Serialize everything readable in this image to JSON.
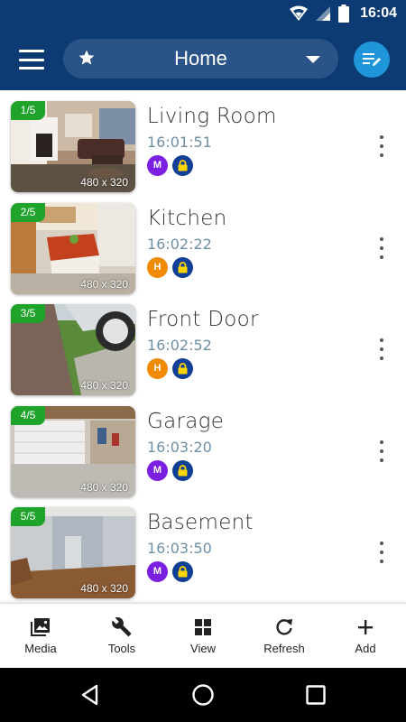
{
  "status_bar": {
    "time": "16:04"
  },
  "header": {
    "selected_group": "Home"
  },
  "colors": {
    "app_bar": "#0b3b72",
    "pill": "#2a5488",
    "edit_button": "#1e96d9",
    "badge_green": "#1fa32b",
    "timestamp": "#6f8fa3",
    "chip_m": "#7b1fe0",
    "chip_h": "#f08a00",
    "lock_blue": "#123f96",
    "lock_gold": "#ffd600"
  },
  "cameras": [
    {
      "index": "1/5",
      "name": "Living Room",
      "time": "16:01:51",
      "resolution": "480 x 320",
      "mode": "M",
      "mode_color": "#7b1fe0"
    },
    {
      "index": "2/5",
      "name": "Kitchen",
      "time": "16:02:22",
      "resolution": "480 x 320",
      "mode": "H",
      "mode_color": "#f08a00"
    },
    {
      "index": "3/5",
      "name": "Front Door",
      "time": "16:02:52",
      "resolution": "480 x 320",
      "mode": "H",
      "mode_color": "#f08a00"
    },
    {
      "index": "4/5",
      "name": "Garage",
      "time": "16:03:20",
      "resolution": "480 x 320",
      "mode": "M",
      "mode_color": "#7b1fe0"
    },
    {
      "index": "5/5",
      "name": "Basement",
      "time": "16:03:50",
      "resolution": "480 x 320",
      "mode": "M",
      "mode_color": "#7b1fe0"
    }
  ],
  "bottom_nav": [
    {
      "label": "Media",
      "icon": "media-icon"
    },
    {
      "label": "Tools",
      "icon": "wrench-icon"
    },
    {
      "label": "View",
      "icon": "grid-icon"
    },
    {
      "label": "Refresh",
      "icon": "refresh-icon"
    },
    {
      "label": "Add",
      "icon": "plus-icon"
    }
  ],
  "icons": {
    "wifi": "wifi-icon",
    "signal": "cell-signal-icon",
    "battery": "battery-icon",
    "menu": "hamburger-menu-icon",
    "star": "star-icon",
    "dropdown": "caret-down-icon",
    "edit": "edit-list-icon",
    "more": "more-vertical-icon",
    "back": "back-triangle-icon",
    "home": "home-circle-icon",
    "recents": "recents-square-icon"
  }
}
